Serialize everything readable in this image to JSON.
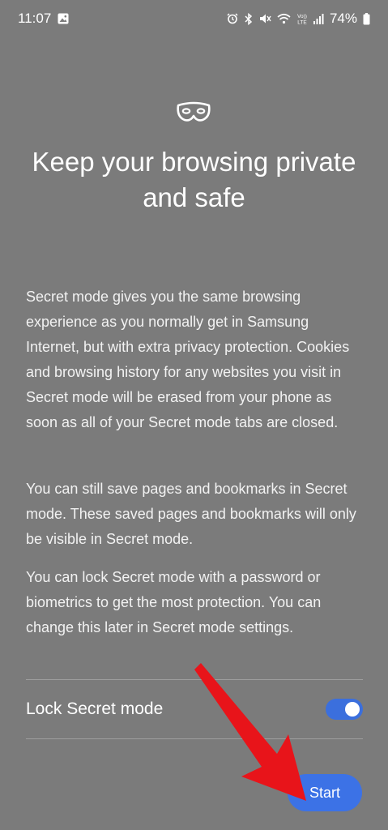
{
  "status_bar": {
    "time": "11:07",
    "battery": "74%",
    "icons": [
      "gallery-icon",
      "alarm-icon",
      "bluetooth-icon",
      "mute-icon",
      "wifi-icon",
      "volte-icon",
      "signal-icon",
      "battery-icon"
    ]
  },
  "header": {
    "icon": "mask-icon",
    "title": "Keep your browsing private and safe"
  },
  "content": {
    "paragraphs": [
      "Secret mode gives you the same browsing experience as you normally get in Samsung Internet, but with extra privacy protection. Cookies and browsing history for any websites you visit in Secret mode will be erased from your phone as soon as all of your Secret mode tabs are closed.",
      "You can still save pages and bookmarks in Secret mode. These saved pages and bookmarks will only be visible in Secret mode.",
      "You can lock Secret mode with a password or biometrics to get the most protection. You can change this later in Secret mode settings."
    ]
  },
  "lock_setting": {
    "label": "Lock Secret mode",
    "enabled": true
  },
  "actions": {
    "start_label": "Start"
  },
  "colors": {
    "background": "#7b7b7b",
    "accent": "#3c72e6",
    "annotation_arrow": "#e8141a"
  }
}
